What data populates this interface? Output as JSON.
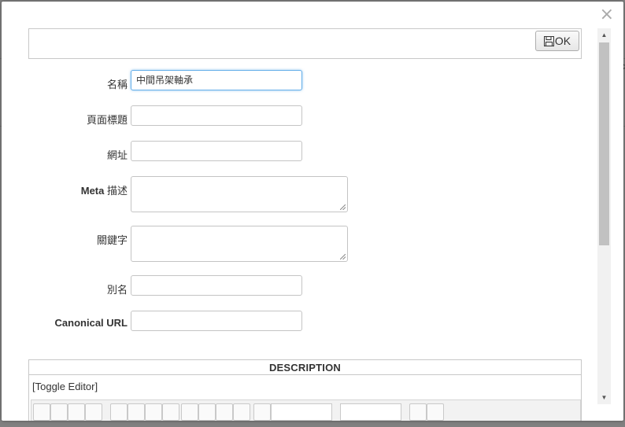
{
  "dialog": {
    "close_glyph": "×",
    "ok_label": "OK"
  },
  "form": {
    "fields": [
      {
        "label": "名稱",
        "value": "中間吊架軸承",
        "type": "input"
      },
      {
        "label": "頁面標題",
        "value": "",
        "type": "input"
      },
      {
        "label": "網址",
        "value": "",
        "type": "input"
      },
      {
        "label_bold": "Meta",
        "label_rest": " 描述",
        "value": "",
        "type": "textarea"
      },
      {
        "label": "關鍵字",
        "value": "",
        "type": "textarea"
      },
      {
        "label": "別名",
        "value": "",
        "type": "input"
      },
      {
        "label_bold": "Canonical URL",
        "value": "",
        "type": "input"
      }
    ]
  },
  "description": {
    "title": "DESCRIPTION",
    "toggle": "[Toggle Editor]"
  },
  "background": {
    "right_glyphs": [
      "c",
      "t"
    ]
  }
}
